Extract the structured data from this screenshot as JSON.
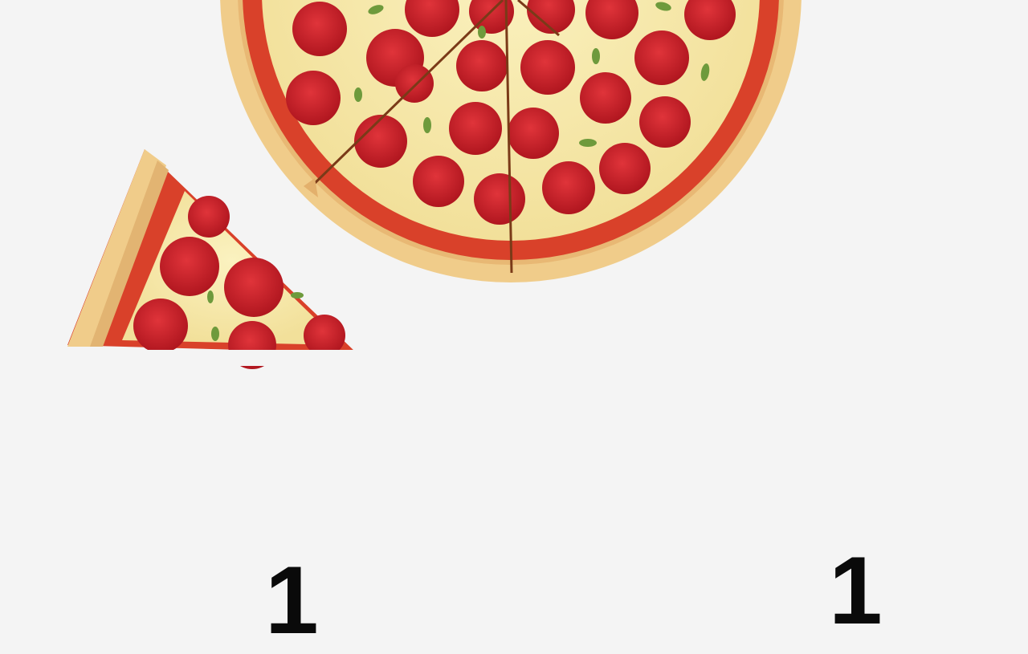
{
  "scene": {
    "subject": "pepperoni-pizza",
    "background_color": "#f4f4f4",
    "crust_color": "#f0cc8a",
    "sauce_color": "#d9412a",
    "cheese_color": "#f6eaa6",
    "pepperoni_color": "#c8202a",
    "herb_color": "#6e9a3c"
  },
  "caption": {
    "left": "1",
    "right": "1"
  }
}
